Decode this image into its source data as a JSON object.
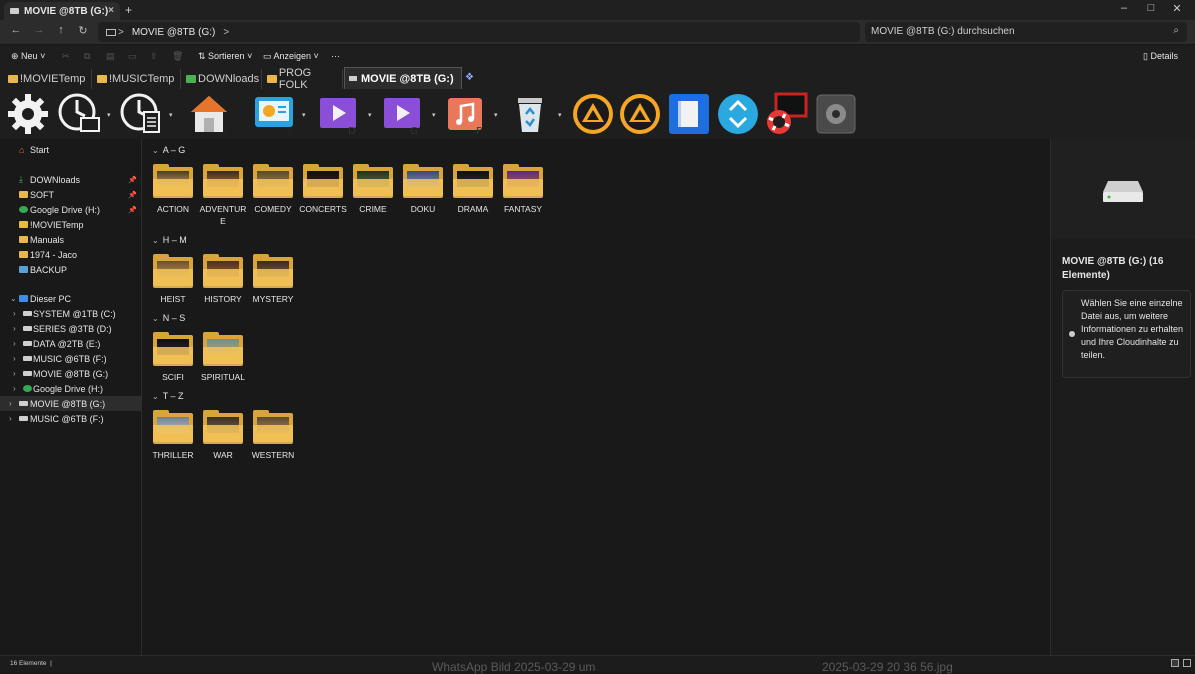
{
  "window": {
    "tab_title": "MOVIE @8TB (G:)",
    "tab_close": "×",
    "tab_new": "+",
    "minimize": "–",
    "maximize": "□",
    "close": "✕"
  },
  "nav": {
    "back": "←",
    "forward": "→",
    "up": "↑",
    "refresh": "↻",
    "address_location": "MOVIE @8TB (G:)",
    "address_sep": ">",
    "search_placeholder": "MOVIE @8TB (G:) durchsuchen"
  },
  "commandbar": {
    "new": "Neu",
    "sort": "Sortieren",
    "view": "Anzeigen",
    "more": "···",
    "details": "Details"
  },
  "folder_tabs": [
    {
      "label": "!MOVIETemp",
      "active": false
    },
    {
      "label": "!MUSICTemp",
      "active": false
    },
    {
      "label": "DOWNloads",
      "active": false
    },
    {
      "label": "PROG FOLK",
      "active": false
    },
    {
      "label": "MOVIE @8TB (G:)",
      "active": true
    }
  ],
  "folder_tab_add": "❖",
  "launcher": {
    "letters": [
      "C",
      "E",
      "D",
      "G",
      "F"
    ],
    "icons": [
      "settings-gear",
      "clock-folder",
      "clock-document",
      "home",
      "presentation",
      "video-d",
      "video-g",
      "music-f",
      "recycle-bin",
      "aimp-1",
      "aimp-2",
      "book",
      "recycle-blue",
      "lifebuoy-monitor",
      "disk-device"
    ]
  },
  "sidebar": {
    "start": "Start",
    "quick": [
      {
        "label": "DOWNloads",
        "icon": "download-icon",
        "pinned": true
      },
      {
        "label": "SOFT",
        "icon": "folder-icon",
        "pinned": true
      },
      {
        "label": "Google Drive (H:)",
        "icon": "google-drive-icon",
        "pinned": true
      },
      {
        "label": "!MOVIETemp",
        "icon": "folder-icon",
        "pinned": false
      },
      {
        "label": "Manuals",
        "icon": "folder-icon",
        "pinned": false
      },
      {
        "label": "1974 - Jaco",
        "icon": "folder-icon",
        "pinned": false
      },
      {
        "label": "BACKUP",
        "icon": "folder-icon",
        "pinned": false
      }
    ],
    "this_pc": "Dieser PC",
    "drives": [
      {
        "label": "SYSTEM @1TB (C:)",
        "icon": "drive-icon"
      },
      {
        "label": "SERIES @3TB (D:)",
        "icon": "drive-icon"
      },
      {
        "label": "DATA @2TB (E:)",
        "icon": "drive-icon"
      },
      {
        "label": "MUSIC @6TB (F:)",
        "icon": "drive-icon"
      },
      {
        "label": "MOVIE @8TB (G:)",
        "icon": "drive-icon"
      },
      {
        "label": "Google Drive (H:)",
        "icon": "google-drive-icon"
      }
    ],
    "extra": [
      {
        "label": "MOVIE @8TB (G:)",
        "selected": true
      },
      {
        "label": "MUSIC @6TB (F:)",
        "selected": false
      }
    ]
  },
  "groups": [
    {
      "label": "A – G",
      "items": [
        {
          "name": "ACTION",
          "c1": "#4a3a28",
          "c2": "#c9a060"
        },
        {
          "name": "ADVENTURE",
          "c1": "#3a2a20",
          "c2": "#b07040"
        },
        {
          "name": "COMEDY",
          "c1": "#5a4830",
          "c2": "#a08050"
        },
        {
          "name": "CONCERTS",
          "c1": "#101010",
          "c2": "#402010"
        },
        {
          "name": "CRIME",
          "c1": "#203020",
          "c2": "#5a7040"
        },
        {
          "name": "DOKU",
          "c1": "#3a4a70",
          "c2": "#8090b0"
        },
        {
          "name": "DRAMA",
          "c1": "#101010",
          "c2": "#303030"
        },
        {
          "name": "FANTASY",
          "c1": "#5a2a80",
          "c2": "#b06040"
        }
      ]
    },
    {
      "label": "H – M",
      "items": [
        {
          "name": "HEIST",
          "c1": "#6a5030",
          "c2": "#c09050"
        },
        {
          "name": "HISTORY",
          "c1": "#4a3020",
          "c2": "#a06030"
        },
        {
          "name": "MYSTERY",
          "c1": "#3a2a1a",
          "c2": "#806040"
        }
      ]
    },
    {
      "label": "N – S",
      "items": [
        {
          "name": "SCIFI",
          "c1": "#101010",
          "c2": "#2a2a2a"
        },
        {
          "name": "SPIRITUAL",
          "c1": "#6a9090",
          "c2": "#c0a060"
        }
      ]
    },
    {
      "label": "T – Z",
      "items": [
        {
          "name": "THRILLER",
          "c1": "#708090",
          "c2": "#c0c0c0"
        },
        {
          "name": "WAR",
          "c1": "#3a3020",
          "c2": "#806040"
        },
        {
          "name": "WESTERN",
          "c1": "#5a4a30",
          "c2": "#b08050"
        }
      ]
    }
  ],
  "details": {
    "title": "MOVIE @8TB (G:) (16 Elemente)",
    "info": "Wählen Sie eine einzelne Datei aus, um weitere Informationen zu erhalten und Ihre Cloudinhalte zu teilen."
  },
  "status": {
    "count": "16 Elemente",
    "sep": "|",
    "ghost_left": "WhatsApp Bild 2025-03-29 um",
    "ghost_right": "2025-03-29 20 36 56.jpg"
  },
  "colors": {
    "folder_back": "#d9a43a",
    "folder_front": "#f3c65a",
    "accent": "#3d8ee6"
  }
}
